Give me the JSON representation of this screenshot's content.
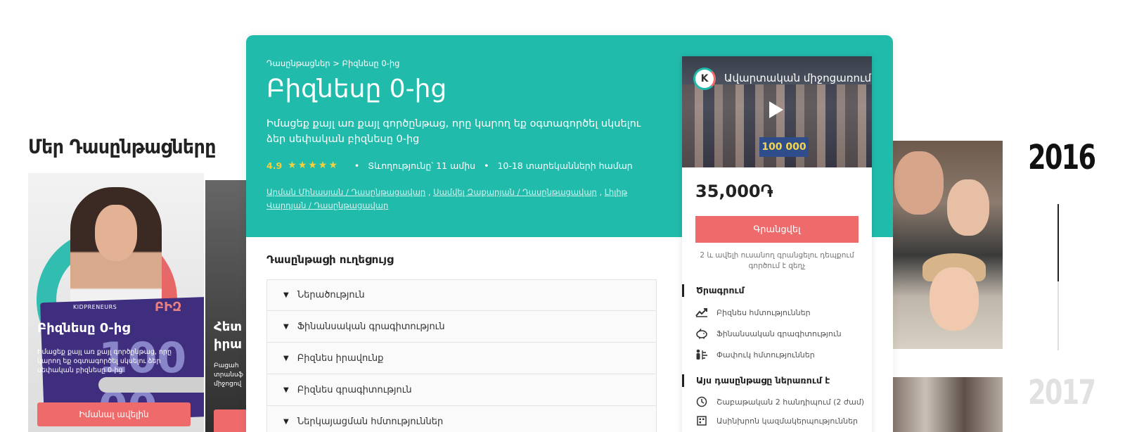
{
  "background": {
    "section_title": "Մեր Դասընթացները",
    "card1": {
      "title": "Բիզնեսը 0-ից",
      "desc": "Իմացեք քայլ առ քայլ գործընթաց, որը կարող եք օգտագործել սկսելու ձեր սեփական բիզնեսը 0-ից",
      "button": "Իմանալ ավելին",
      "board_logo": "KIDPRENEURS",
      "board_big": "ԲԻԶ",
      "board_num": "100 00"
    },
    "card2": {
      "title": "Հետ\nիրա",
      "desc": "Բացահ\nտրանսֆ\nմիջոցով"
    },
    "years": [
      "2016",
      "2017"
    ]
  },
  "modal": {
    "breadcrumb": {
      "root": "Դասընթացներ",
      "separator": ">",
      "current": "Բիզնեսը 0-ից"
    },
    "title": "Բիզնեսը 0-ից",
    "subtitle": "Իմացեք քայլ առ քայլ գործընթաց, որը կարող եք օգտագործել սկսելու ձեր սեփական բիզնեսը 0-ից",
    "rating": "4.9",
    "stars": "★★★★★",
    "duration": "Տևողությունը՝ 11 ամիս",
    "age": "10-18 տարեկանների համար",
    "instructors": [
      "Արման Մինասյան / Դասընթացավար",
      "Սամվել Զաքարյան / Դասընթացավար",
      "Լիլիթ Վարդյան / Դասընթացավար"
    ],
    "toc_title": "Դասընթացի ուղեցույց",
    "toc_items": [
      "Ներածություն",
      "Ֆինանսական գրագիտություն",
      "Բիզնես իրավունք",
      "Բիզնես գրագիտություն",
      "Ներկայացման հմտություններ"
    ],
    "side": {
      "video_title": "Ավարտական միջոցառում",
      "video_logo": "K",
      "video_sign": "100 000",
      "price": "35,000֏",
      "enroll_label": "Գրանցվել",
      "enroll_note": "2 և ավելի ուսանող գրանցելու դեպքում գործում է զեղչ",
      "program_title": "Ծրագրում",
      "program": [
        {
          "icon": "trending-up-icon",
          "label": "Բիզնես հմտություններ"
        },
        {
          "icon": "piggy-bank-icon",
          "label": "Ֆինանսական գրագիտություն"
        },
        {
          "icon": "person-chart-icon",
          "label": "Փափուկ հմտություններ"
        }
      ],
      "includes_title": "Այս դասընթացը ներառում է",
      "includes": [
        {
          "icon": "clock-icon",
          "label": "Շաբաթական 2 հանդիպում (2 ժամ)"
        },
        {
          "icon": "grid-icon",
          "label": "Ասինխրոն կազմակերպություններ"
        }
      ]
    }
  },
  "colors": {
    "teal": "#21bbab",
    "coral": "#ef6a6a",
    "star": "#f9cf3a"
  }
}
